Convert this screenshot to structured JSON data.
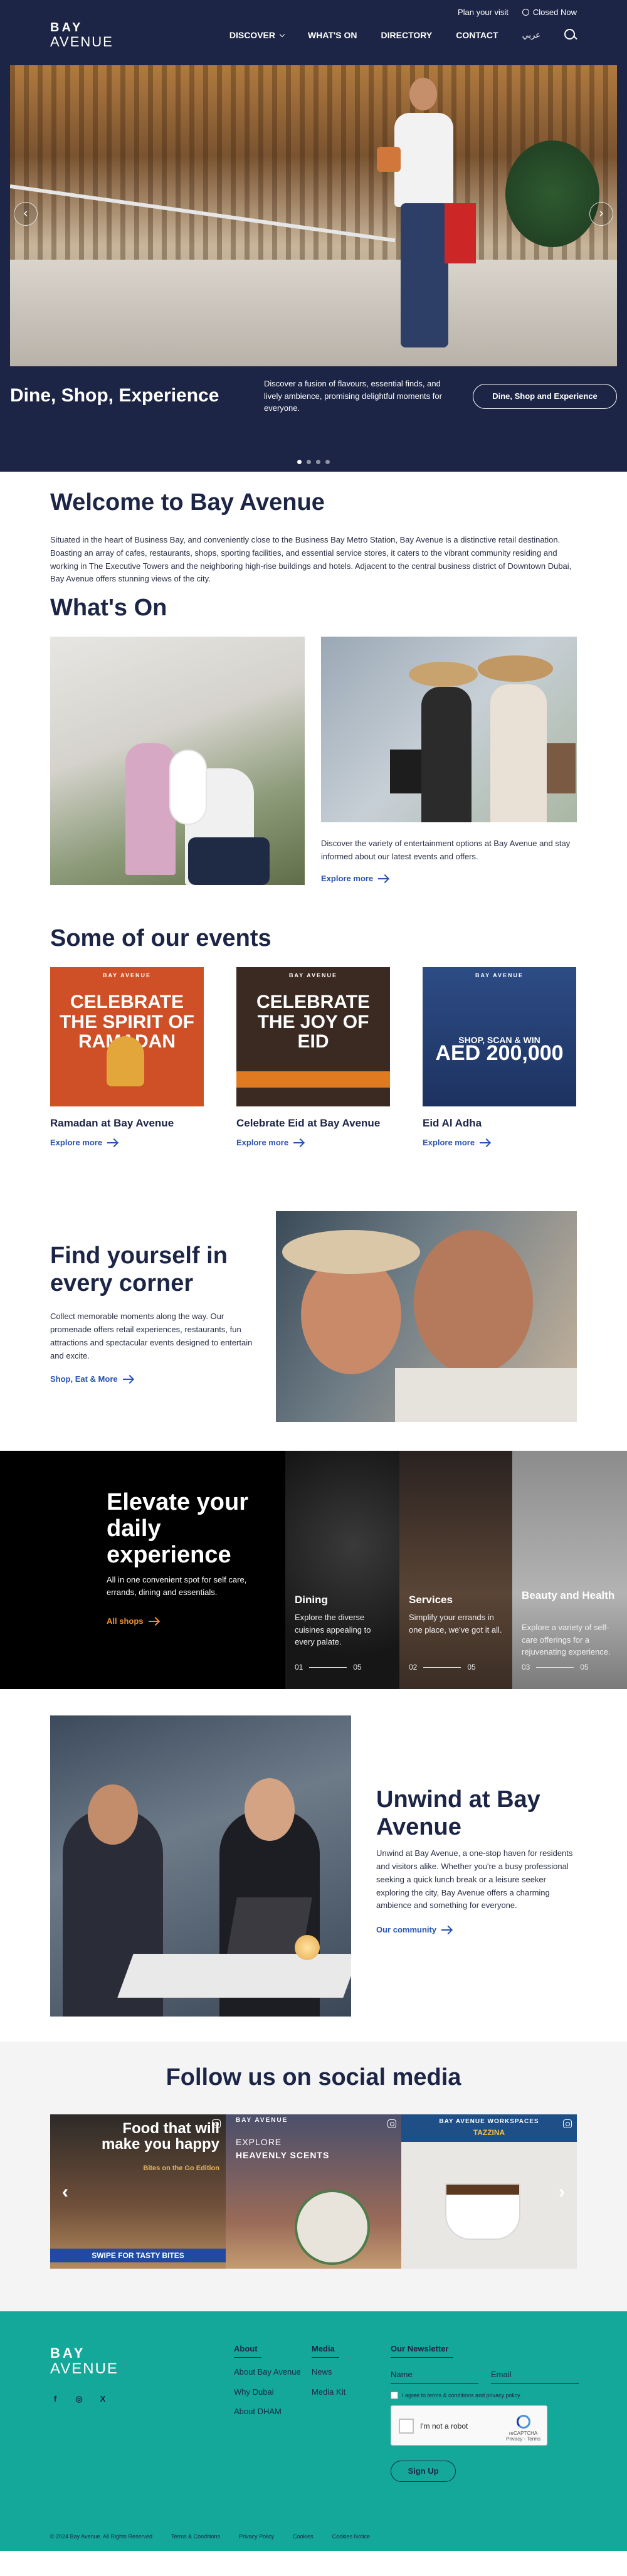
{
  "header": {
    "logo_line1": "BAY",
    "logo_line2": "AVENUE",
    "plan_visit": "Plan your visit",
    "status": "Closed Now",
    "nav": {
      "discover": "DISCOVER",
      "whats_on": "WHAT'S ON",
      "directory": "DIRECTORY",
      "contact": "CONTACT",
      "arabic": "عربي"
    }
  },
  "hero": {
    "title": "Dine, Shop, Experience",
    "text": "Discover a fusion of flavours, essential finds, and lively ambience, promising delightful moments for everyone.",
    "cta": "Dine, Shop and Experience",
    "prev": "‹",
    "next": "›"
  },
  "welcome": {
    "title": "Welcome to Bay Avenue",
    "text": "Situated in the heart of Business Bay, and conveniently close to the Business Bay Metro Station, Bay Avenue is a distinctive retail destination. Boasting an array of cafes, restaurants, shops, sporting facilities, and essential service stores, it caters to the vibrant community residing and working in The Executive Towers and the neighboring high-rise buildings and hotels. Adjacent to the central business district of Downtown Dubai, Bay Avenue offers stunning views of the city."
  },
  "whats_on": {
    "title": "What's On",
    "text": "Discover the variety of entertainment options at Bay Avenue and stay informed about our latest events and offers.",
    "link": "Explore more"
  },
  "events": {
    "title": "Some of our events",
    "items": [
      {
        "brand": "BAY AVENUE",
        "poster": "CELEBRATE THE SPIRIT OF RAMADAN",
        "title": "Ramadan at Bay Avenue",
        "link": "Explore more"
      },
      {
        "brand": "BAY AVENUE",
        "poster": "CELEBRATE THE JOY OF EID",
        "title": "Celebrate Eid at Bay Avenue",
        "link": "Explore more"
      },
      {
        "brand": "BAY AVENUE",
        "poster_small": "SHOP, SCAN & WIN",
        "poster": "AED 200,000",
        "title": "Eid Al Adha",
        "link": "Explore more"
      }
    ]
  },
  "corner": {
    "title": "Find yourself in every corner",
    "text": "Collect memorable moments along the way. Our promenade offers retail experiences, restaurants, fun attractions and spectacular events designed to entertain and excite.",
    "link": "Shop, Eat & More"
  },
  "elevate": {
    "title": "Elevate your daily experience",
    "text": "All in one convenient spot for self care, errands, dining and essentials.",
    "link": "All shops",
    "panels": [
      {
        "title": "Dining",
        "text": "Explore the diverse cuisines appealing to every palate.",
        "page": "01",
        "total": "05"
      },
      {
        "title": "Services",
        "text": "Simplify your errands in one place, we've got it all.",
        "page": "02",
        "total": "05"
      },
      {
        "title": "Beauty and Health",
        "text": "Explore a variety of self-care offerings for a rejuvenating experience.",
        "page": "03",
        "total": "05"
      }
    ]
  },
  "unwind": {
    "title": "Unwind at Bay Avenue",
    "text": "Unwind at Bay Avenue, a one-stop haven for residents and visitors alike. Whether you're a busy professional seeking a quick lunch break or a leisure seeker exploring the city, Bay Avenue offers a charming ambience and something for everyone.",
    "link": "Our community"
  },
  "social": {
    "title": "Follow us on social media",
    "tiles": [
      {
        "headline": "Food that will make you happy",
        "sub": "Bites on the Go Edition",
        "footer": "SWIPE FOR TASTY BITES"
      },
      {
        "logo": "BAY AVENUE",
        "sub": "EXPLORE",
        "headline": "HEAVENLY SCENTS"
      },
      {
        "top": "BAY AVENUE WORKSPACES",
        "brand": "TAZZINA"
      }
    ],
    "prev": "‹",
    "next": "›"
  },
  "footer": {
    "logo_line1": "BAY",
    "logo_line2": "AVENUE",
    "socials": [
      "f",
      "◎",
      "X"
    ],
    "about": {
      "title": "About",
      "links": [
        "About Bay Avenue",
        "Why Dubai",
        "About DHAM"
      ]
    },
    "media": {
      "title": "Media",
      "links": [
        "News",
        "Media Kit"
      ]
    },
    "newsletter": {
      "title": "Our Newsletter",
      "name_placeholder": "Name",
      "email_placeholder": "Email",
      "agree": "I agree to terms & conditions and privacy policy",
      "captcha": "I'm not a robot",
      "captcha_brand": "reCAPTCHA",
      "captcha_links": "Privacy - Terms",
      "signup": "Sign Up"
    },
    "bottom": [
      "© 2024 Bay Avenue. All Rights Reserved",
      "Terms & Conditions",
      "Privacy Policy",
      "Cookies",
      "Cookies Notice"
    ]
  }
}
